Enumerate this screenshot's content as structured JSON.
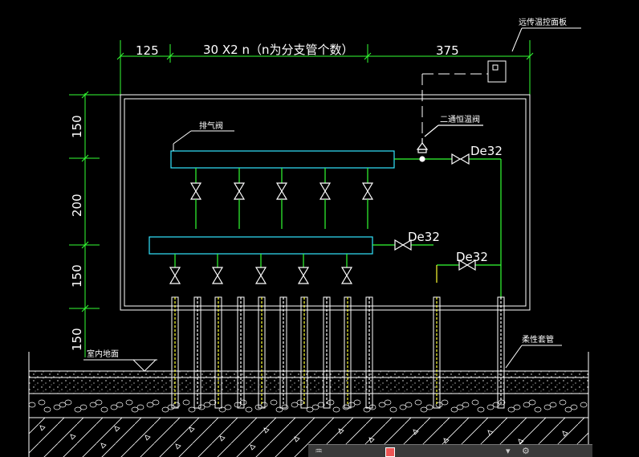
{
  "dimensions": {
    "top_left": "125",
    "top_middle": "30 X2 n（n为分支管个数）",
    "top_right": "375",
    "left_1": "150",
    "left_2": "200",
    "left_3": "150",
    "left_4": "150"
  },
  "labels": {
    "thermostat_panel": "远传温控面板",
    "air_vent": "排气阀",
    "two_way_valve": "二通恒温阀",
    "indoor_floor": "室内地面",
    "flexible_sleeve": "柔性套管",
    "de32_upper": "De32",
    "de32_middle": "De32",
    "de32_lower": "De32"
  },
  "panel": {
    "item1": "",
    "item2": ""
  },
  "icons": {
    "valve": "butterfly-valve-icon",
    "panel_left": "layers-icon",
    "panel_right": "settings-icon"
  },
  "colors": {
    "frame": "#ffffff",
    "pipe": "#33ff33",
    "manifold": "#33e6ff",
    "dimension": "#33ff33",
    "wall_pipe": "#ffff33",
    "background": "#000000"
  }
}
